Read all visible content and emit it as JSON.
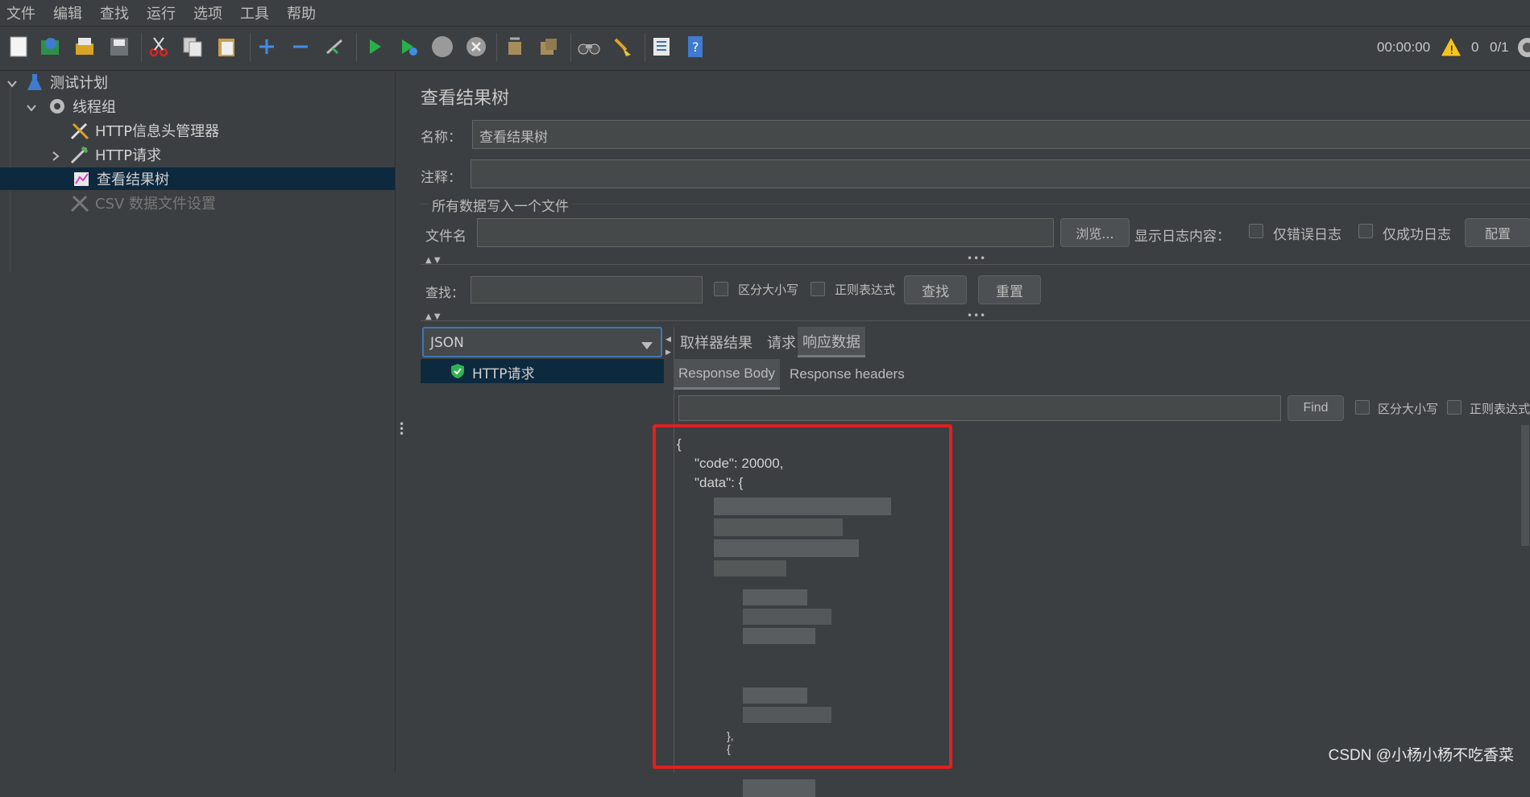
{
  "menu": [
    "文件",
    "编辑",
    "查找",
    "运行",
    "选项",
    "工具",
    "帮助"
  ],
  "toolbar": {
    "icons": [
      "new-icon",
      "templates-icon",
      "open-icon",
      "save-icon",
      "cut-icon",
      "copy-icon",
      "paste-icon",
      "expand-icon",
      "collapse-icon",
      "toggle-icon",
      "start-icon",
      "start-no-pause-icon",
      "stop-icon",
      "shutdown-icon",
      "clear-icon",
      "clear-all-icon",
      "search-icon",
      "reset-search-icon",
      "function-helper-icon",
      "help-icon"
    ],
    "timer": "00:00:00",
    "warnings": "0",
    "threads": "0/1"
  },
  "tree": {
    "items": [
      {
        "label": "测试计划",
        "icon": "flask-icon"
      },
      {
        "label": "线程组",
        "icon": "gear-icon"
      },
      {
        "label": "HTTP信息头管理器",
        "icon": "tools-icon"
      },
      {
        "label": "HTTP请求",
        "icon": "pipette-icon"
      },
      {
        "label": "查看结果树",
        "icon": "chart-icon"
      },
      {
        "label": "CSV 数据文件设置",
        "icon": "tools-disabled-icon"
      }
    ]
  },
  "panel": {
    "title": "查看结果树",
    "name_label": "名称：",
    "name_value": "查看结果树",
    "comment_label": "注释：",
    "comment_value": "",
    "file_section": "所有数据写入一个文件",
    "filename_label": "文件名",
    "filename_value": "",
    "browse_button": "浏览...",
    "log_label": "显示日志内容：",
    "errors_only": "仅错误日志",
    "success_only": "仅成功日志",
    "config_button": "配置",
    "search_label": "查找：",
    "search_value": "",
    "case_sensitive": "区分大小写",
    "regex": "正则表达式",
    "find_button": "查找",
    "reset_button": "重置"
  },
  "results": {
    "renderer": "JSON",
    "samples": [
      {
        "label": "HTTP请求",
        "status": "success"
      }
    ],
    "tabs": [
      "取样器结果",
      "请求",
      "响应数据"
    ],
    "active_tab": "响应数据",
    "subtabs": [
      "Response Body",
      "Response headers"
    ],
    "active_subtab": "Response Body",
    "find_value": "",
    "find_button": "Find",
    "case_sensitive": "区分大小写",
    "regex": "正则表达式",
    "body_lines": [
      "{",
      "\"code\": 20000,",
      "\"data\": {",
      "},",
      "{"
    ]
  },
  "watermark": "CSDN @小杨小杨不吃香菜",
  "colors": {
    "highlight_box": "#e02020",
    "selection": "#0d293e"
  }
}
